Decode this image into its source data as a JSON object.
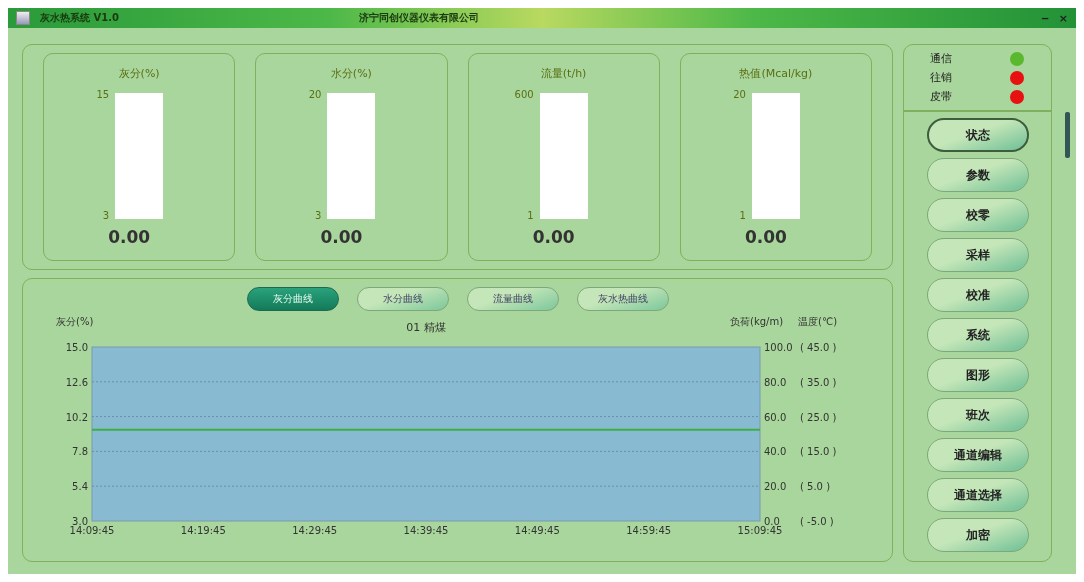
{
  "window": {
    "title": "灰水热系统  V1.0",
    "company": "济宁同创仪器仪表有限公司",
    "controls": [
      "‒",
      "×"
    ]
  },
  "gauges": [
    {
      "label": "灰分(%)",
      "max": "15",
      "min": "3",
      "reading": "0.00"
    },
    {
      "label": "水分(%)",
      "max": "20",
      "min": "3",
      "reading": "0.00"
    },
    {
      "label": "流量(t/h)",
      "max": "600",
      "min": "1",
      "reading": "0.00"
    },
    {
      "label": "热值(Mcal/kg)",
      "max": "20",
      "min": "1",
      "reading": "0.00"
    }
  ],
  "curve_tabs": [
    {
      "label": "灰分曲线",
      "selected": true
    },
    {
      "label": "水分曲线",
      "selected": false
    },
    {
      "label": "流量曲线",
      "selected": false
    },
    {
      "label": "灰水热曲线",
      "selected": false
    }
  ],
  "chart": {
    "right_labels": [
      "负荷(kg/m)",
      "温度(℃)"
    ],
    "right_ticks": [
      {
        "load": "100.0",
        "temp": "( 45.0 )"
      },
      {
        "load": "80.0",
        "temp": "( 35.0 )"
      },
      {
        "load": "60.0",
        "temp": "( 25.0 )"
      },
      {
        "load": "40.0",
        "temp": "( 15.0 )"
      },
      {
        "load": "20.0",
        "temp": "( 5.0 )"
      },
      {
        "load": "0.0",
        "temp": "( -5.0 )"
      }
    ],
    "chart_data": {
      "type": "line",
      "title": "01 精煤",
      "ylabel": "灰分(%)",
      "categories": [
        "14:09:45",
        "14:19:45",
        "14:29:45",
        "14:39:45",
        "14:49:45",
        "14:59:45",
        "15:09:45"
      ],
      "series": [
        {
          "color": "#3cb043",
          "values": [
            9.3,
            9.3,
            9.3,
            9.3,
            9.3,
            9.3,
            9.3
          ]
        }
      ],
      "grid": true,
      "ylim": [
        3,
        15
      ],
      "yticks": [
        {
          "value": 3,
          "label": "3.0"
        },
        {
          "value": 5.4,
          "label": "5.4"
        },
        {
          "value": 7.8,
          "label": "7.8"
        },
        {
          "value": 10.2,
          "label": "10.2"
        },
        {
          "value": 12.6,
          "label": "12.6"
        },
        {
          "value": 15,
          "label": "15.0"
        }
      ]
    }
  },
  "status": [
    {
      "label": "通信",
      "color": "#5ab82e"
    },
    {
      "label": "往销",
      "color": "#e81010"
    },
    {
      "label": "皮带",
      "color": "#e81010"
    }
  ],
  "menu": [
    {
      "label": "状态",
      "selected": true
    },
    {
      "label": "参数",
      "selected": false
    },
    {
      "label": "校零",
      "selected": false
    },
    {
      "label": "采样",
      "selected": false
    },
    {
      "label": "校准",
      "selected": false
    },
    {
      "label": "系统",
      "selected": false
    },
    {
      "label": "图形",
      "selected": false
    },
    {
      "label": "班次",
      "selected": false
    },
    {
      "label": "通道编辑",
      "selected": false
    },
    {
      "label": "通道选择",
      "selected": false
    },
    {
      "label": "加密",
      "selected": false
    }
  ]
}
